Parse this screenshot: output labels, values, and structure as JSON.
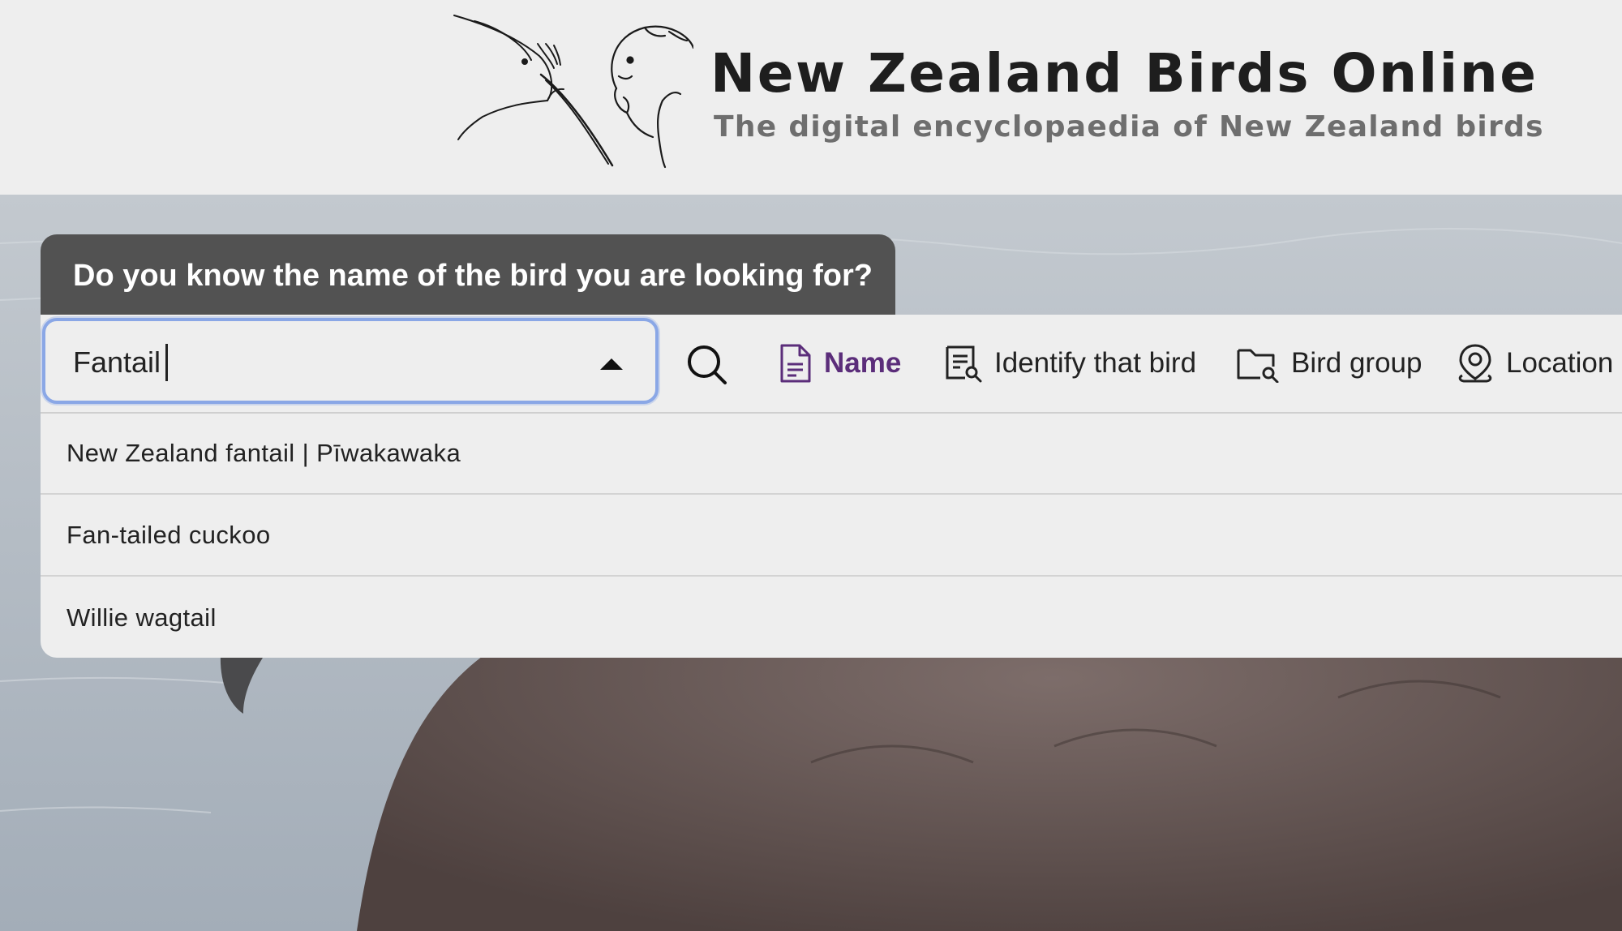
{
  "header": {
    "title": "New Zealand Birds Online",
    "subtitle": "The digital encyclopaedia of New Zealand birds",
    "logo": "kiwi-and-kakapo-line-drawing"
  },
  "search": {
    "question": "Do you know the name of the bird you are looking for?",
    "value": "Fantail",
    "focus_color": "#8aa7e6"
  },
  "nav": {
    "items": [
      {
        "label": "Name",
        "icon": "document-icon",
        "active": true
      },
      {
        "label": "Identify that bird",
        "icon": "document-search-icon",
        "active": false
      },
      {
        "label": "Bird group",
        "icon": "folder-search-icon",
        "active": false
      },
      {
        "label": "Location",
        "icon": "location-pin-icon",
        "active": false
      }
    ],
    "active_color": "#5b2d7a"
  },
  "suggestions": [
    "New Zealand fantail | Pīwakawaka",
    "Fan-tailed cuckoo",
    "Willie wagtail"
  ],
  "hero": {
    "image": "petrel-on-water-photo"
  }
}
